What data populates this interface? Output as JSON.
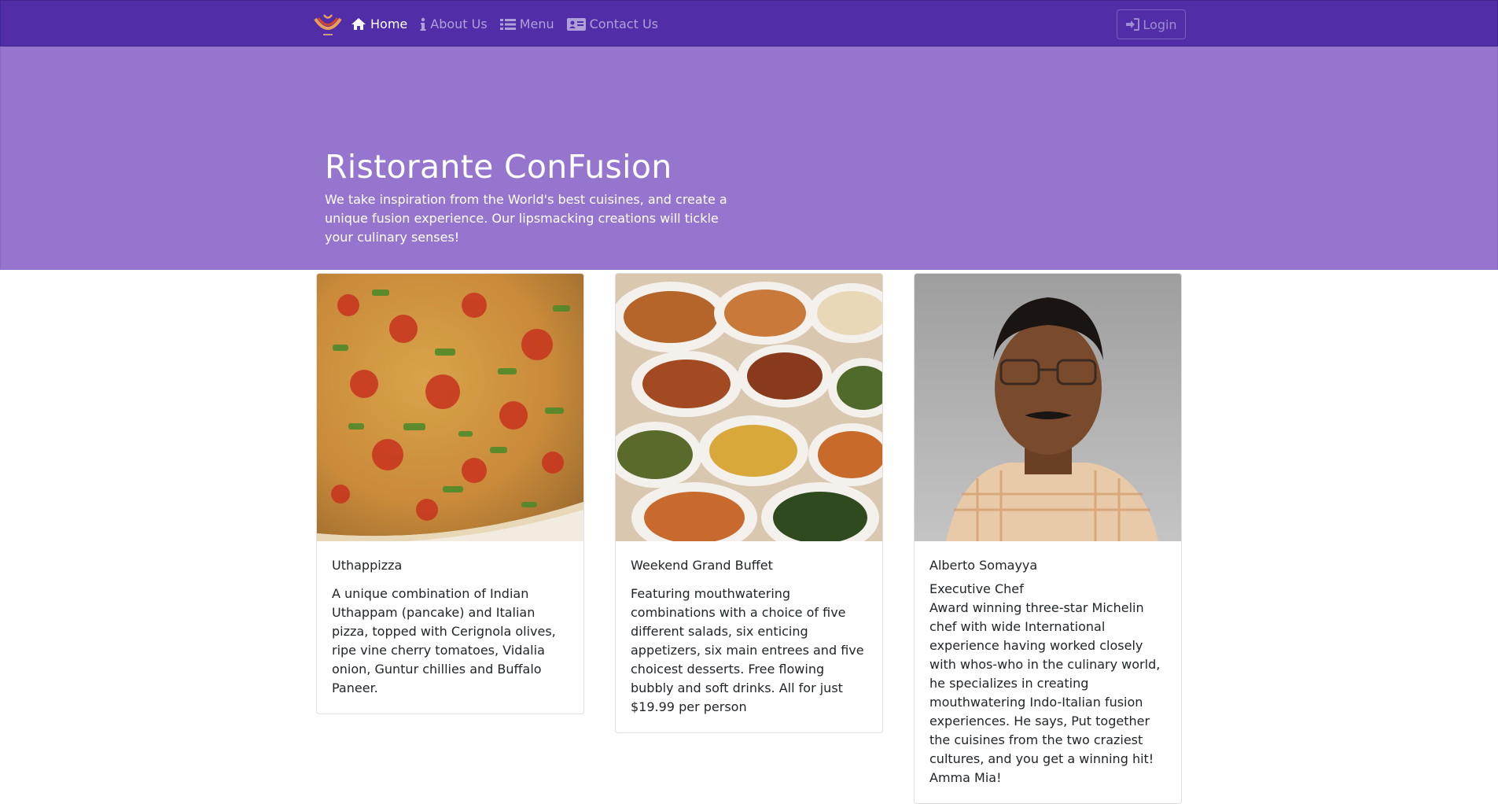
{
  "navbar": {
    "brand_icon": "logo-icon",
    "items": [
      {
        "label": "Home",
        "icon": "home-icon",
        "active": true
      },
      {
        "label": "About Us",
        "icon": "info-icon",
        "active": false
      },
      {
        "label": "Menu",
        "icon": "list-icon",
        "active": false
      },
      {
        "label": "Contact Us",
        "icon": "address-card-icon",
        "active": false
      }
    ],
    "login_label": "Login",
    "login_icon": "sign-in-icon",
    "colors": {
      "navbar": "#512da8",
      "jumbotron": "#9575cd"
    }
  },
  "jumbotron": {
    "title": "Ristorante ConFusion",
    "text": "We take inspiration from the World's best cuisines, and create a unique fusion experience. Our lipsmacking creations will tickle your culinary senses!"
  },
  "cards": [
    {
      "image": "pizza-photo",
      "title": "Uthappizza",
      "text": "A unique combination of Indian Uthappam (pancake) and Italian pizza, topped with Cerignola olives, ripe vine cherry tomatoes, Vidalia onion, Guntur chillies and Buffalo Paneer."
    },
    {
      "image": "buffet-photo",
      "title": "Weekend Grand Buffet",
      "text": "Featuring mouthwatering combinations with a choice of five different salads, six enticing appetizers, six main entrees and five choicest desserts. Free flowing bubbly and soft drinks. All for just $19.99 per person"
    },
    {
      "image": "chef-photo",
      "title": "Alberto Somayya",
      "subtitle": "Executive Chef",
      "text": "Award winning three-star Michelin chef with wide International experience having worked closely with whos-who in the culinary world, he specializes in creating mouthwatering Indo-Italian fusion experiences. He says, Put together the cuisines from the two craziest cultures, and you get a winning hit! Amma Mia!"
    }
  ]
}
